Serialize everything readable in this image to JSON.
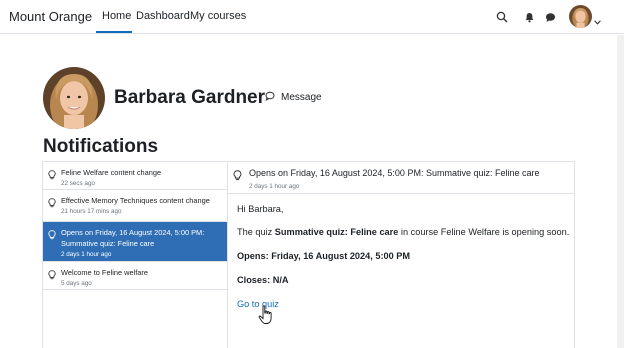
{
  "navbar": {
    "brand": "Mount Orange",
    "items": [
      {
        "label": "Home"
      },
      {
        "label": "Dashboard"
      },
      {
        "label": "My courses"
      }
    ],
    "icons": [
      "search-icon",
      "bell-icon",
      "chat-icon",
      "user-menu-caret-icon"
    ]
  },
  "profile": {
    "name": "Barbara Gardner",
    "message_label": "Message"
  },
  "page_title": "Notifications",
  "notifications": [
    {
      "title": "Feline Welfare content change",
      "time": "22 secs ago"
    },
    {
      "title": "Effective Memory Techniques content change",
      "time": "21 hours 17 mins ago"
    },
    {
      "title": "Opens on Friday, 16 August 2024, 5:00 PM: Summative quiz: Feline care",
      "time": "2 days 1 hour ago"
    },
    {
      "title": "Welcome to Feline welfare",
      "time": "5 days ago"
    }
  ],
  "detail": {
    "title": "Opens on Friday, 16 August 2024, 5:00 PM: Summative quiz: Feline care",
    "time": "2 days 1 hour ago",
    "greeting": "Hi Barbara,",
    "body_prefix": "The quiz ",
    "quiz_name": "Summative quiz: Feline care",
    "body_suffix": " in course Feline Welfare is opening soon.",
    "opens": "Opens: Friday, 16 August 2024, 5:00 PM",
    "closes": "Closes: N/A",
    "link_label": "Go to quiz"
  },
  "colors": {
    "accent": "#0f6cbf",
    "selected_bg": "#2f6eb5"
  }
}
